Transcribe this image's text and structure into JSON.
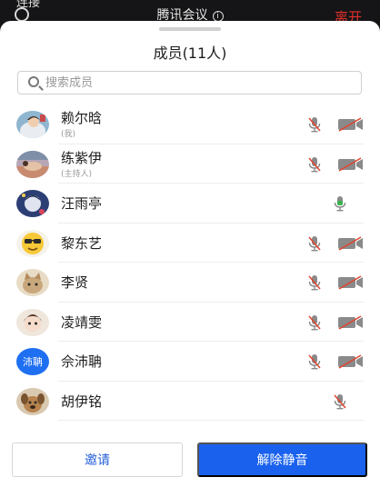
{
  "topbar": {
    "left_text": "连接",
    "title": "腾讯会议",
    "info_glyph": "i",
    "leave": "离开"
  },
  "sheet": {
    "title": "成员(11人)",
    "search_placeholder": "搜索成员"
  },
  "members": [
    {
      "name": "赖尔晗",
      "sub": "(我)",
      "mic": "muted",
      "camera": "off",
      "avatar": "photo-child"
    },
    {
      "name": "练紫伊",
      "sub": "(主持人)",
      "mic": "muted",
      "camera": "off",
      "avatar": "photo-beach"
    },
    {
      "name": "汪雨亭",
      "sub": "",
      "mic": "active",
      "camera": "none",
      "avatar": "photo-anime"
    },
    {
      "name": "黎东艺",
      "sub": "",
      "mic": "muted",
      "camera": "off",
      "avatar": "emoji-sunglasses"
    },
    {
      "name": "李贤",
      "sub": "",
      "mic": "muted",
      "camera": "off",
      "avatar": "photo-cat"
    },
    {
      "name": "凌靖雯",
      "sub": "",
      "mic": "muted",
      "camera": "off",
      "avatar": "photo-girl"
    },
    {
      "name": "佘沛聃",
      "sub": "",
      "mic": "muted",
      "camera": "off",
      "avatar": "text",
      "avatar_text": "沛聃"
    },
    {
      "name": "胡伊铭",
      "sub": "",
      "mic": "muted",
      "camera": "none",
      "avatar": "photo-dog"
    }
  ],
  "buttons": {
    "invite": "邀请",
    "unmute": "解除静音"
  },
  "colors": {
    "accent": "#1a62ee",
    "leave": "#e0302a",
    "mic_active": "#38b24a",
    "muted_slash": "#e0452f"
  }
}
